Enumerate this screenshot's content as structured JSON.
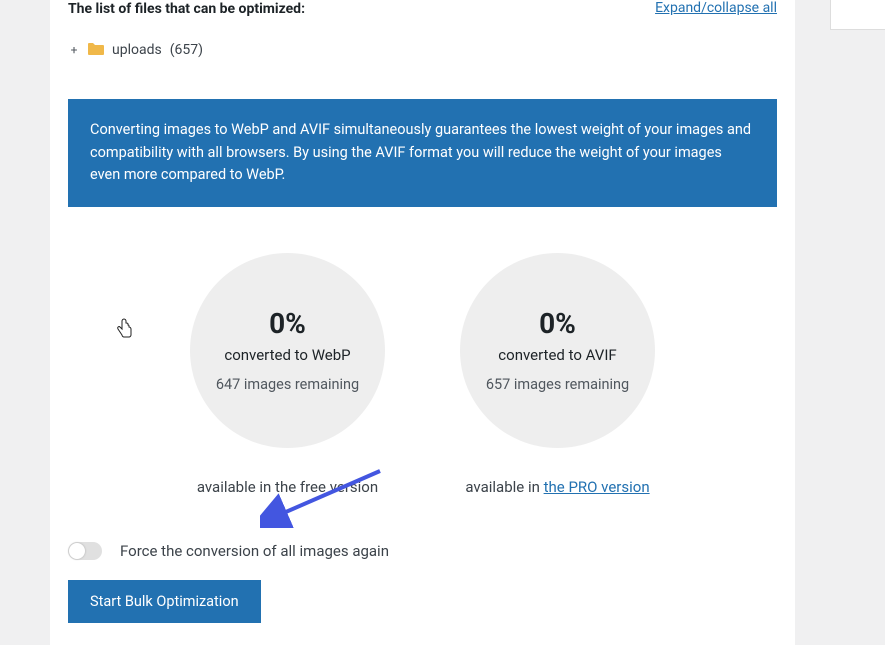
{
  "file_list": {
    "title": "The list of files that can be optimized:",
    "expand_label": "Expand/collapse all",
    "items": [
      {
        "name": "uploads",
        "count": "(657)"
      }
    ]
  },
  "info_banner": "Converting images to WebP and AVIF simultaneously guarantees the lowest weight of your images and compatibility with all browsers. By using the AVIF format you will reduce the weight of your images even more compared to WebP.",
  "stats": {
    "webp": {
      "percent": "0%",
      "sub": "converted to WebP",
      "remaining": "647 images remaining",
      "availability": "available in the free version"
    },
    "avif": {
      "percent": "0%",
      "sub": "converted to AVIF",
      "remaining": "657 images remaining",
      "availability_prefix": "available in ",
      "availability_link": "the PRO version"
    }
  },
  "force_toggle": {
    "label": "Force the conversion of all images again",
    "value": false
  },
  "start_button": "Start Bulk Optimization"
}
